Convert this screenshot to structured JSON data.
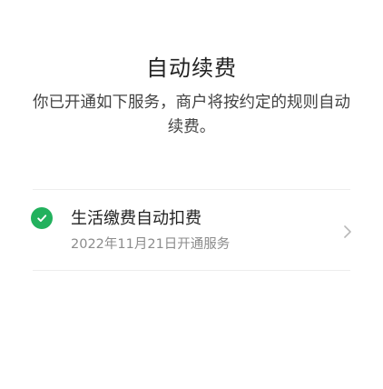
{
  "header": {
    "title": "自动续费",
    "description": "你已开通如下服务，商户将按约定的规则自动续费。"
  },
  "services": [
    {
      "name": "生活缴费自动扣费",
      "date_text": "2022年11月21日开通服务",
      "icon": "check-circle-icon",
      "status_color": "#22b15d"
    }
  ]
}
